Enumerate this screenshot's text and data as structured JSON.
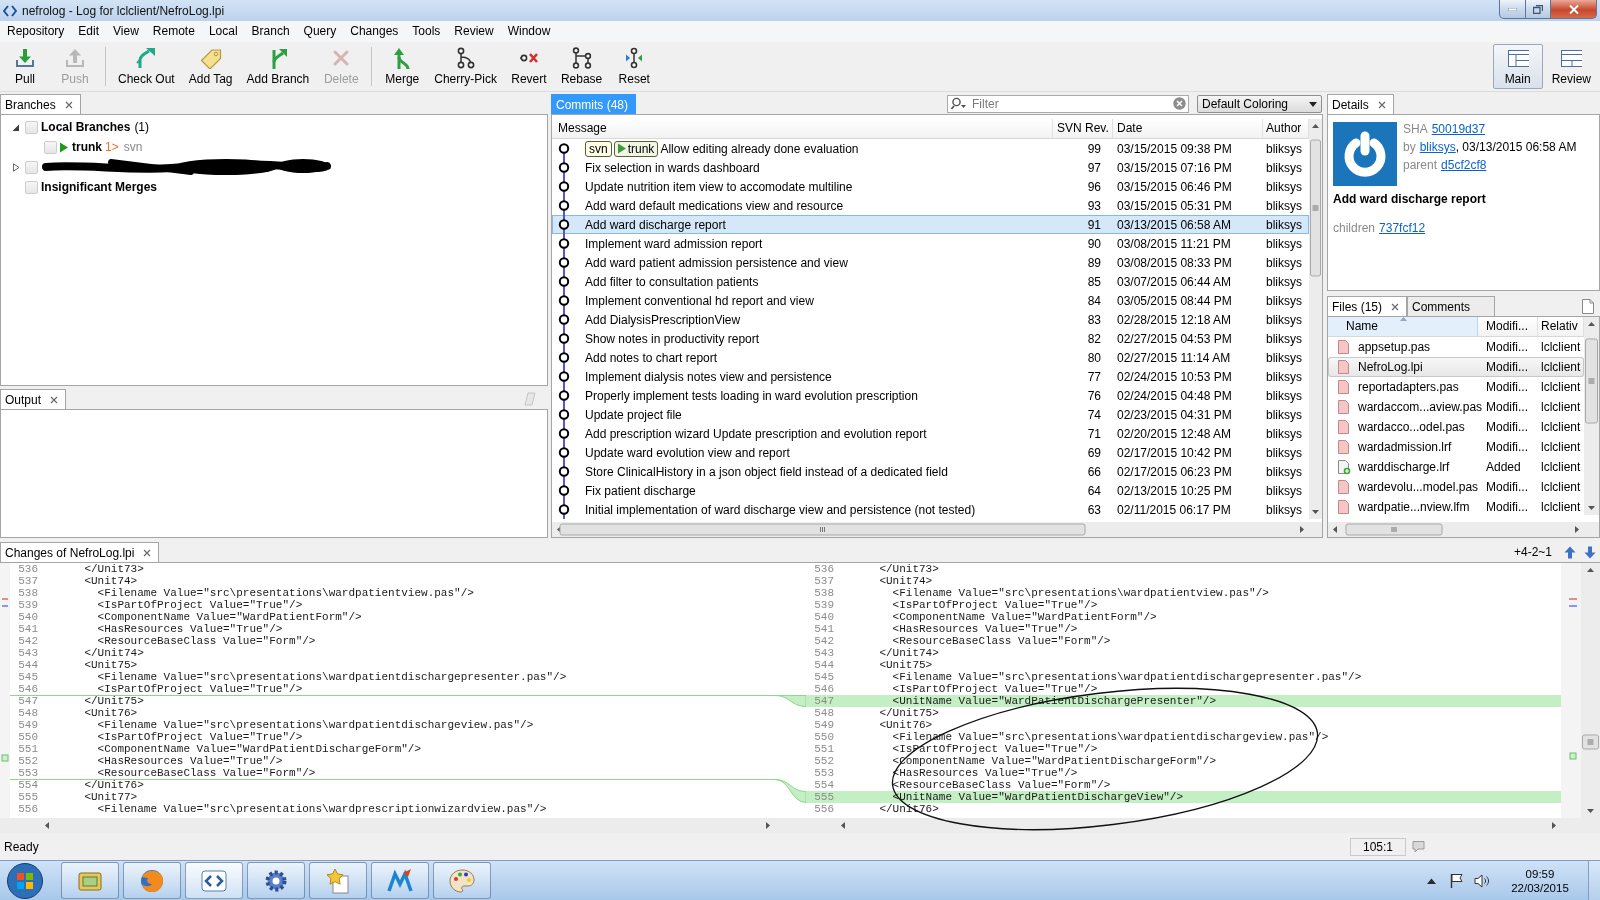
{
  "window": {
    "title": "nefrolog - Log for lclclient/NefroLog.lpi"
  },
  "menu": [
    "Repository",
    "Edit",
    "View",
    "Remote",
    "Local",
    "Branch",
    "Query",
    "Changes",
    "Tools",
    "Review",
    "Window"
  ],
  "toolbar": {
    "groups": [
      [
        {
          "kind": "pull",
          "label": "Pull",
          "disabled": false
        },
        {
          "kind": "push",
          "label": "Push",
          "disabled": true
        }
      ],
      [
        {
          "kind": "checkout",
          "label": "Check Out",
          "disabled": false
        },
        {
          "kind": "tag",
          "label": "Add Tag",
          "disabled": false
        },
        {
          "kind": "branch",
          "label": "Add Branch",
          "disabled": false
        },
        {
          "kind": "delete",
          "label": "Delete",
          "disabled": true
        }
      ],
      [
        {
          "kind": "merge",
          "label": "Merge",
          "disabled": false
        },
        {
          "kind": "cherrypick",
          "label": "Cherry-Pick",
          "disabled": false
        },
        {
          "kind": "revert",
          "label": "Revert",
          "disabled": false
        },
        {
          "kind": "rebase",
          "label": "Rebase",
          "disabled": false
        },
        {
          "kind": "reset",
          "label": "Reset",
          "disabled": false
        }
      ]
    ],
    "perspectives": [
      {
        "kind": "main",
        "label": "Main",
        "selected": true
      },
      {
        "kind": "review",
        "label": "Review",
        "selected": false
      }
    ]
  },
  "branches": {
    "tab": {
      "label": "Branches",
      "focused": false,
      "closable": true
    },
    "tree": [
      {
        "kind": "group",
        "label": "Local Branches",
        "count": "(1)",
        "expanded": true,
        "checked": false,
        "children": [
          {
            "kind": "branch",
            "label": "trunk",
            "ahead": "1>",
            "tracking": "svn",
            "current": true,
            "checked": false
          }
        ]
      },
      {
        "kind": "redacted",
        "expanded": false,
        "checked": false
      },
      {
        "kind": "group",
        "label": "Insignificant Merges",
        "checked": false
      }
    ]
  },
  "output": {
    "tab": {
      "label": "Output",
      "focused": false,
      "closable": true
    }
  },
  "commits": {
    "tab": {
      "label": "Commits (48)",
      "focused": true,
      "closable": false
    },
    "filter": {
      "placeholder": "Filter"
    },
    "coloring": "Default Coloring",
    "columns": [
      "Message",
      "SVN Rev.",
      "Date",
      "Author"
    ],
    "rows": [
      {
        "refs": [
          {
            "label": "svn",
            "current": false
          },
          {
            "label": "trunk",
            "current": true
          }
        ],
        "message": "Allow editing already done evaluation",
        "rev": "99",
        "date": "03/15/2015 09:38 PM",
        "author": "bliksys",
        "selected": false
      },
      {
        "refs": [],
        "message": "Fix selection in wards dashboard",
        "rev": "97",
        "date": "03/15/2015 07:16 PM",
        "author": "bliksys",
        "selected": false
      },
      {
        "refs": [],
        "message": "Update nutrition item view to accomodate multiline",
        "rev": "96",
        "date": "03/15/2015 06:46 PM",
        "author": "bliksys",
        "selected": false
      },
      {
        "refs": [],
        "message": "Add ward default medications view and resource",
        "rev": "93",
        "date": "03/15/2015 05:31 PM",
        "author": "bliksys",
        "selected": false
      },
      {
        "refs": [],
        "message": "Add ward discharge report",
        "rev": "91",
        "date": "03/13/2015 06:58 AM",
        "author": "bliksys",
        "selected": true
      },
      {
        "refs": [],
        "message": "Implement ward admission report",
        "rev": "90",
        "date": "03/08/2015 11:21 PM",
        "author": "bliksys",
        "selected": false
      },
      {
        "refs": [],
        "message": "Add ward patient admission persistence and view",
        "rev": "89",
        "date": "03/08/2015 08:33 PM",
        "author": "bliksys",
        "selected": false
      },
      {
        "refs": [],
        "message": "Add filter to consultation patients",
        "rev": "85",
        "date": "03/07/2015 06:44 AM",
        "author": "bliksys",
        "selected": false
      },
      {
        "refs": [],
        "message": "Implement conventional hd report and view",
        "rev": "84",
        "date": "03/05/2015 08:44 PM",
        "author": "bliksys",
        "selected": false
      },
      {
        "refs": [],
        "message": "Add DialysisPrescriptionView",
        "rev": "83",
        "date": "02/28/2015 12:18 AM",
        "author": "bliksys",
        "selected": false
      },
      {
        "refs": [],
        "message": "Show notes in productivity report",
        "rev": "82",
        "date": "02/27/2015 04:53 PM",
        "author": "bliksys",
        "selected": false
      },
      {
        "refs": [],
        "message": "Add notes to chart report",
        "rev": "80",
        "date": "02/27/2015 11:14 AM",
        "author": "bliksys",
        "selected": false
      },
      {
        "refs": [],
        "message": "Implement dialysis notes view and persistence",
        "rev": "77",
        "date": "02/24/2015 10:53 PM",
        "author": "bliksys",
        "selected": false
      },
      {
        "refs": [],
        "message": "Properly implement tests loading in ward evolution prescription",
        "rev": "76",
        "date": "02/24/2015 04:48 PM",
        "author": "bliksys",
        "selected": false
      },
      {
        "refs": [],
        "message": "Update project file",
        "rev": "74",
        "date": "02/23/2015 04:31 PM",
        "author": "bliksys",
        "selected": false
      },
      {
        "refs": [],
        "message": "Add prescription wizard Update prescription and evolution report",
        "rev": "71",
        "date": "02/20/2015 12:48 AM",
        "author": "bliksys",
        "selected": false
      },
      {
        "refs": [],
        "message": "Update ward evolution view and report",
        "rev": "69",
        "date": "02/17/2015 10:42 PM",
        "author": "bliksys",
        "selected": false
      },
      {
        "refs": [],
        "message": "Store ClinicalHistory in a json object field instead of a dedicated field",
        "rev": "66",
        "date": "02/17/2015 06:23 PM",
        "author": "bliksys",
        "selected": false
      },
      {
        "refs": [],
        "message": "Fix patient discharge",
        "rev": "64",
        "date": "02/13/2015 10:25 PM",
        "author": "bliksys",
        "selected": false
      },
      {
        "refs": [],
        "message": "Initial implementation of ward discharge view and persistence (not tested)",
        "rev": "63",
        "date": "02/11/2015 06:17 PM",
        "author": "bliksys",
        "selected": false
      }
    ]
  },
  "details": {
    "tab": {
      "label": "Details",
      "focused": false,
      "closable": true
    },
    "sha_label": "SHA",
    "sha": "50019d37",
    "by_label": "by",
    "author": "bliksys",
    "author_suffix": ", 03/13/2015 06:58 AM",
    "parent_label": "parent",
    "parent": "d5cf2cf8",
    "message": "Add ward discharge report",
    "children_label": "children",
    "children": "737fcf12"
  },
  "files": {
    "tabs": [
      {
        "label": "Files (15)",
        "selected": true,
        "closable": true
      },
      {
        "label": "Comments",
        "selected": false,
        "closable": false
      }
    ],
    "columns": [
      {
        "label": "Name",
        "sorted": true
      },
      {
        "label": "Modifi...",
        "sorted": false
      },
      {
        "label": "Relativ",
        "sorted": false
      }
    ],
    "rows": [
      {
        "kind": "modified",
        "name": "appsetup.pas",
        "status": "Modifi...",
        "path": "lclclient",
        "selected": false
      },
      {
        "kind": "modified",
        "name": "NefroLog.lpi",
        "status": "Modifi...",
        "path": "lclclient",
        "selected": true
      },
      {
        "kind": "modified",
        "name": "reportadapters.pas",
        "status": "Modifi...",
        "path": "lclclient",
        "selected": false
      },
      {
        "kind": "modified",
        "name": "wardaccom...aview.pas",
        "status": "Modifi...",
        "path": "lclclient",
        "selected": false
      },
      {
        "kind": "modified",
        "name": "wardacco...odel.pas",
        "status": "Modifi...",
        "path": "lclclient",
        "selected": false
      },
      {
        "kind": "modified",
        "name": "wardadmission.lrf",
        "status": "Modifi...",
        "path": "lclclient",
        "selected": false
      },
      {
        "kind": "added",
        "name": "warddischarge.lrf",
        "status": "Added",
        "path": "lclclient",
        "selected": false
      },
      {
        "kind": "modified",
        "name": "wardevolu...model.pas",
        "status": "Modifi...",
        "path": "lclclient",
        "selected": false
      },
      {
        "kind": "modified",
        "name": "wardpatie...nview.lfm",
        "status": "Modifi...",
        "path": "lclclient",
        "selected": false
      }
    ]
  },
  "changes": {
    "tab": {
      "label": "Changes of NefroLog.lpi",
      "focused": false,
      "closable": true
    },
    "summary": "+4-2~1",
    "left": [
      {
        "number": "536",
        "text": "    </Unit73>",
        "kind": "context"
      },
      {
        "number": "537",
        "text": "    <Unit74>",
        "kind": "context"
      },
      {
        "number": "538",
        "text": "      <Filename Value=\"src\\presentations\\wardpatientview.pas\"/>",
        "kind": "context"
      },
      {
        "number": "539",
        "text": "      <IsPartOfProject Value=\"True\"/>",
        "kind": "context"
      },
      {
        "number": "540",
        "text": "      <ComponentName Value=\"WardPatientForm\"/>",
        "kind": "context"
      },
      {
        "number": "541",
        "text": "      <HasResources Value=\"True\"/>",
        "kind": "context"
      },
      {
        "number": "542",
        "text": "      <ResourceBaseClass Value=\"Form\"/>",
        "kind": "context"
      },
      {
        "number": "543",
        "text": "    </Unit74>",
        "kind": "context"
      },
      {
        "number": "544",
        "text": "    <Unit75>",
        "kind": "context"
      },
      {
        "number": "545",
        "text": "      <Filename Value=\"src\\presentations\\wardpatientdischargepresenter.pas\"/>",
        "kind": "context"
      },
      {
        "number": "546",
        "text": "      <IsPartOfProject Value=\"True\"/>",
        "kind": "context"
      },
      {
        "number": "547",
        "text": "    </Unit75>",
        "kind": "gap"
      },
      {
        "number": "548",
        "text": "    <Unit76>",
        "kind": "context"
      },
      {
        "number": "549",
        "text": "      <Filename Value=\"src\\presentations\\wardpatientdischargeview.pas\"/>",
        "kind": "context"
      },
      {
        "number": "550",
        "text": "      <IsPartOfProject Value=\"True\"/>",
        "kind": "context"
      },
      {
        "number": "551",
        "text": "      <ComponentName Value=\"WardPatientDischargeForm\"/>",
        "kind": "context"
      },
      {
        "number": "552",
        "text": "      <HasResources Value=\"True\"/>",
        "kind": "context"
      },
      {
        "number": "553",
        "text": "      <ResourceBaseClass Value=\"Form\"/>",
        "kind": "context"
      },
      {
        "number": "554",
        "text": "    </Unit76>",
        "kind": "gap"
      },
      {
        "number": "555",
        "text": "    <Unit77>",
        "kind": "context"
      },
      {
        "number": "556",
        "text": "      <Filename Value=\"src\\presentations\\wardprescriptionwizardview.pas\"/>",
        "kind": "context"
      }
    ],
    "right": [
      {
        "number": "536",
        "text": "    </Unit73>",
        "kind": "context"
      },
      {
        "number": "537",
        "text": "    <Unit74>",
        "kind": "context"
      },
      {
        "number": "538",
        "text": "      <Filename Value=\"src\\presentations\\wardpatientview.pas\"/>",
        "kind": "context"
      },
      {
        "number": "539",
        "text": "      <IsPartOfProject Value=\"True\"/>",
        "kind": "context"
      },
      {
        "number": "540",
        "text": "      <ComponentName Value=\"WardPatientForm\"/>",
        "kind": "context"
      },
      {
        "number": "541",
        "text": "      <HasResources Value=\"True\"/>",
        "kind": "context"
      },
      {
        "number": "542",
        "text": "      <ResourceBaseClass Value=\"Form\"/>",
        "kind": "context"
      },
      {
        "number": "543",
        "text": "    </Unit74>",
        "kind": "context"
      },
      {
        "number": "544",
        "text": "    <Unit75>",
        "kind": "context"
      },
      {
        "number": "545",
        "text": "      <Filename Value=\"src\\presentations\\wardpatientdischargepresenter.pas\"/>",
        "kind": "context"
      },
      {
        "number": "546",
        "text": "      <IsPartOfProject Value=\"True\"/>",
        "kind": "context"
      },
      {
        "number": "547",
        "text": "      <UnitName Value=\"WardPatientDischargePresenter\"/>",
        "kind": "added"
      },
      {
        "number": "548",
        "text": "    </Unit75>",
        "kind": "context"
      },
      {
        "number": "549",
        "text": "    <Unit76>",
        "kind": "context"
      },
      {
        "number": "550",
        "text": "      <Filename Value=\"src\\presentations\\wardpatientdischargeview.pas\"/>",
        "kind": "context"
      },
      {
        "number": "551",
        "text": "      <IsPartOfProject Value=\"True\"/>",
        "kind": "context"
      },
      {
        "number": "552",
        "text": "      <ComponentName Value=\"WardPatientDischargeForm\"/>",
        "kind": "context"
      },
      {
        "number": "553",
        "text": "      <HasResources Value=\"True\"/>",
        "kind": "context"
      },
      {
        "number": "554",
        "text": "      <ResourceBaseClass Value=\"Form\"/>",
        "kind": "context"
      },
      {
        "number": "555",
        "text": "      <UnitName Value=\"WardPatientDischargeView\"/>",
        "kind": "added"
      },
      {
        "number": "556",
        "text": "    </Unit76>",
        "kind": "context"
      }
    ]
  },
  "status_bar": {
    "message": "Ready",
    "position": "105:1"
  },
  "taskbar": {
    "time": "09:59",
    "date": "22/03/2015"
  }
}
